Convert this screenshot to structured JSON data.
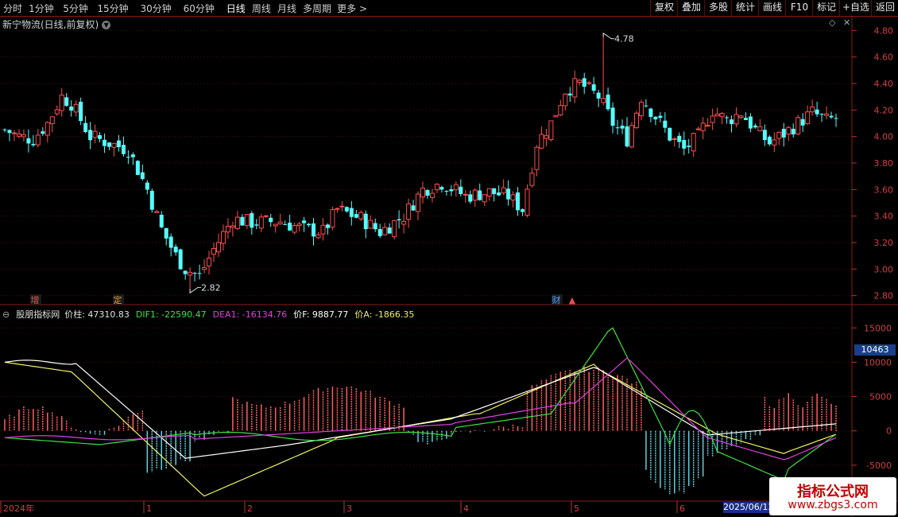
{
  "toolbar": {
    "periods": [
      "分时",
      "1分钟",
      "5分钟",
      "15分钟",
      "30分钟",
      "60分钟",
      "日线",
      "周线",
      "月线",
      "多周期",
      "更多 >"
    ],
    "active_period": "日线",
    "buttons": [
      "复权",
      "叠加",
      "多股",
      "统计",
      "画线",
      "F10",
      "标记",
      "+自选",
      "返回"
    ]
  },
  "main_chart": {
    "title": "新宁物流(日线,前复权)",
    "dropdown_icon": "chevron-down-icon",
    "y_ticks": [
      "4.80",
      "4.60",
      "4.40",
      "4.20",
      "4.00",
      "3.80",
      "3.60",
      "3.40",
      "3.20",
      "3.00",
      "2.80"
    ],
    "high_label": "4.78",
    "low_label": "2.82",
    "event_markers": [
      {
        "label": "增",
        "color": "#e05050"
      },
      {
        "label": "定",
        "color": "#e0a030"
      },
      {
        "label": "财",
        "color": "#4aa0ff"
      },
      {
        "label": "▲",
        "color": "#e05050"
      }
    ]
  },
  "indicator": {
    "name": "股朋指标网",
    "fields": [
      {
        "label": "价柱: 47310.83",
        "color": "#e0e0e0"
      },
      {
        "label": "DIF1: -22590.47",
        "color": "#40e040"
      },
      {
        "label": "DEA1: -16134.76",
        "color": "#e040e0"
      },
      {
        "label": "价F: 9887.77",
        "color": "#ffffff"
      },
      {
        "label": "价A: -1866.35",
        "color": "#f0f060"
      }
    ],
    "y_ticks": [
      "15000",
      "10000",
      "5000",
      "0",
      "-5000"
    ],
    "current_value": "10463"
  },
  "x_axis": {
    "labels": [
      "2024年",
      "1",
      "2",
      "3",
      "4",
      "5",
      "6"
    ],
    "highlight_date": "2025/06/13"
  },
  "watermark": {
    "line1": "指标公式网",
    "line2": "www.zbgs3.com"
  },
  "chart_data": {
    "type": "candlestick",
    "price_range": [
      2.75,
      4.85
    ],
    "indicator_range": [
      -10000,
      17000
    ],
    "colors": {
      "up": "#ff4d4d",
      "down": "#54ffff"
    }
  }
}
